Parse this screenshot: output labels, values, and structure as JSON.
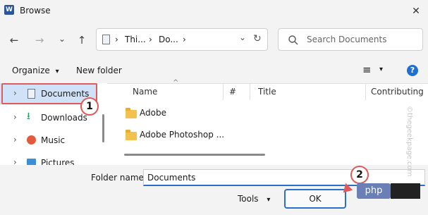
{
  "window": {
    "title": "Browse",
    "app_icon_letter": "W",
    "close_glyph": "✕"
  },
  "nav": {
    "back": "←",
    "forward": "→",
    "recent": "⌄",
    "up": "↑"
  },
  "address": {
    "segments": [
      "Thi...",
      "Do..."
    ],
    "sep": "›",
    "dropdown": "⌄",
    "refresh": "↻"
  },
  "search": {
    "placeholder": "Search Documents",
    "icon": "search-icon"
  },
  "toolbar": {
    "organize": "Organize",
    "organize_caret": "▾",
    "new_folder": "New folder",
    "view_icon": "≡",
    "view_caret": "▾",
    "help": "?"
  },
  "tree": {
    "items": [
      {
        "label": "Documents",
        "chev": "›"
      },
      {
        "label": "Downloads",
        "chev": "›"
      },
      {
        "label": "Music",
        "chev": "›"
      },
      {
        "label": "Pictures",
        "chev": "›"
      }
    ]
  },
  "columns": {
    "name": "Name",
    "hash": "#",
    "title": "Title",
    "contributing": "Contributing",
    "sort_caret": "^"
  },
  "files": [
    {
      "name": "Adobe"
    },
    {
      "name": "Adobe Photoshop ..."
    }
  ],
  "bottom": {
    "folder_label": "Folder name:",
    "folder_value": "Documents",
    "tools": "Tools",
    "tools_caret": "▾",
    "ok": "OK"
  },
  "callouts": {
    "one": "1",
    "two": "2"
  },
  "overlay": {
    "php": "php",
    "watermark": "©thegeekpage.com"
  },
  "colors": {
    "accent": "#2a6fc9",
    "callout": "#e05a5a",
    "folder": "#f2c14e"
  }
}
